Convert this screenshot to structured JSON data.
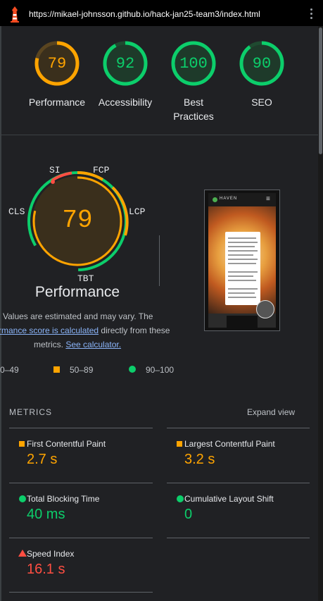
{
  "browser": {
    "url": "https://mikael-johnsson.github.io/hack-jan25-team3/index.html"
  },
  "colors": {
    "good": "#0cce6b",
    "average": "#ffa400",
    "fail": "#ff4e42"
  },
  "categories": [
    {
      "label": "Performance",
      "score": 79,
      "color": "#ffa400"
    },
    {
      "label": "Accessibility",
      "score": 92,
      "color": "#0cce6b"
    },
    {
      "label": "Best Practices",
      "score": 100,
      "color": "#0cce6b"
    },
    {
      "label": "SEO",
      "score": 90,
      "color": "#0cce6b"
    }
  ],
  "performance": {
    "score": "79",
    "title": "Performance",
    "segments": {
      "si": "SI",
      "fcp": "FCP",
      "lcp": "LCP",
      "tbt": "TBT",
      "cls": "CLS"
    }
  },
  "screenshot": {
    "brand": "HAVEN",
    "menu": "≡"
  },
  "note": {
    "line1": "Values are estimated and may vary. The",
    "link1": "rmance score is calculated",
    "line2": " directly from these",
    "line3": "metrics. ",
    "link2": "See calculator."
  },
  "legend": {
    "fail": "0–49",
    "average": "50–89",
    "pass": "90–100"
  },
  "metrics_section": {
    "heading": "METRICS",
    "expand": "Expand view"
  },
  "metrics": [
    {
      "name": "First Contentful Paint",
      "value": "2.7 s",
      "rating": "average"
    },
    {
      "name": "Largest Contentful Paint",
      "value": "3.2 s",
      "rating": "average"
    },
    {
      "name": "Total Blocking Time",
      "value": "40 ms",
      "rating": "good"
    },
    {
      "name": "Cumulative Layout Shift",
      "value": "0",
      "rating": "good"
    },
    {
      "name": "Speed Index",
      "value": "16.1 s",
      "rating": "fail"
    }
  ]
}
